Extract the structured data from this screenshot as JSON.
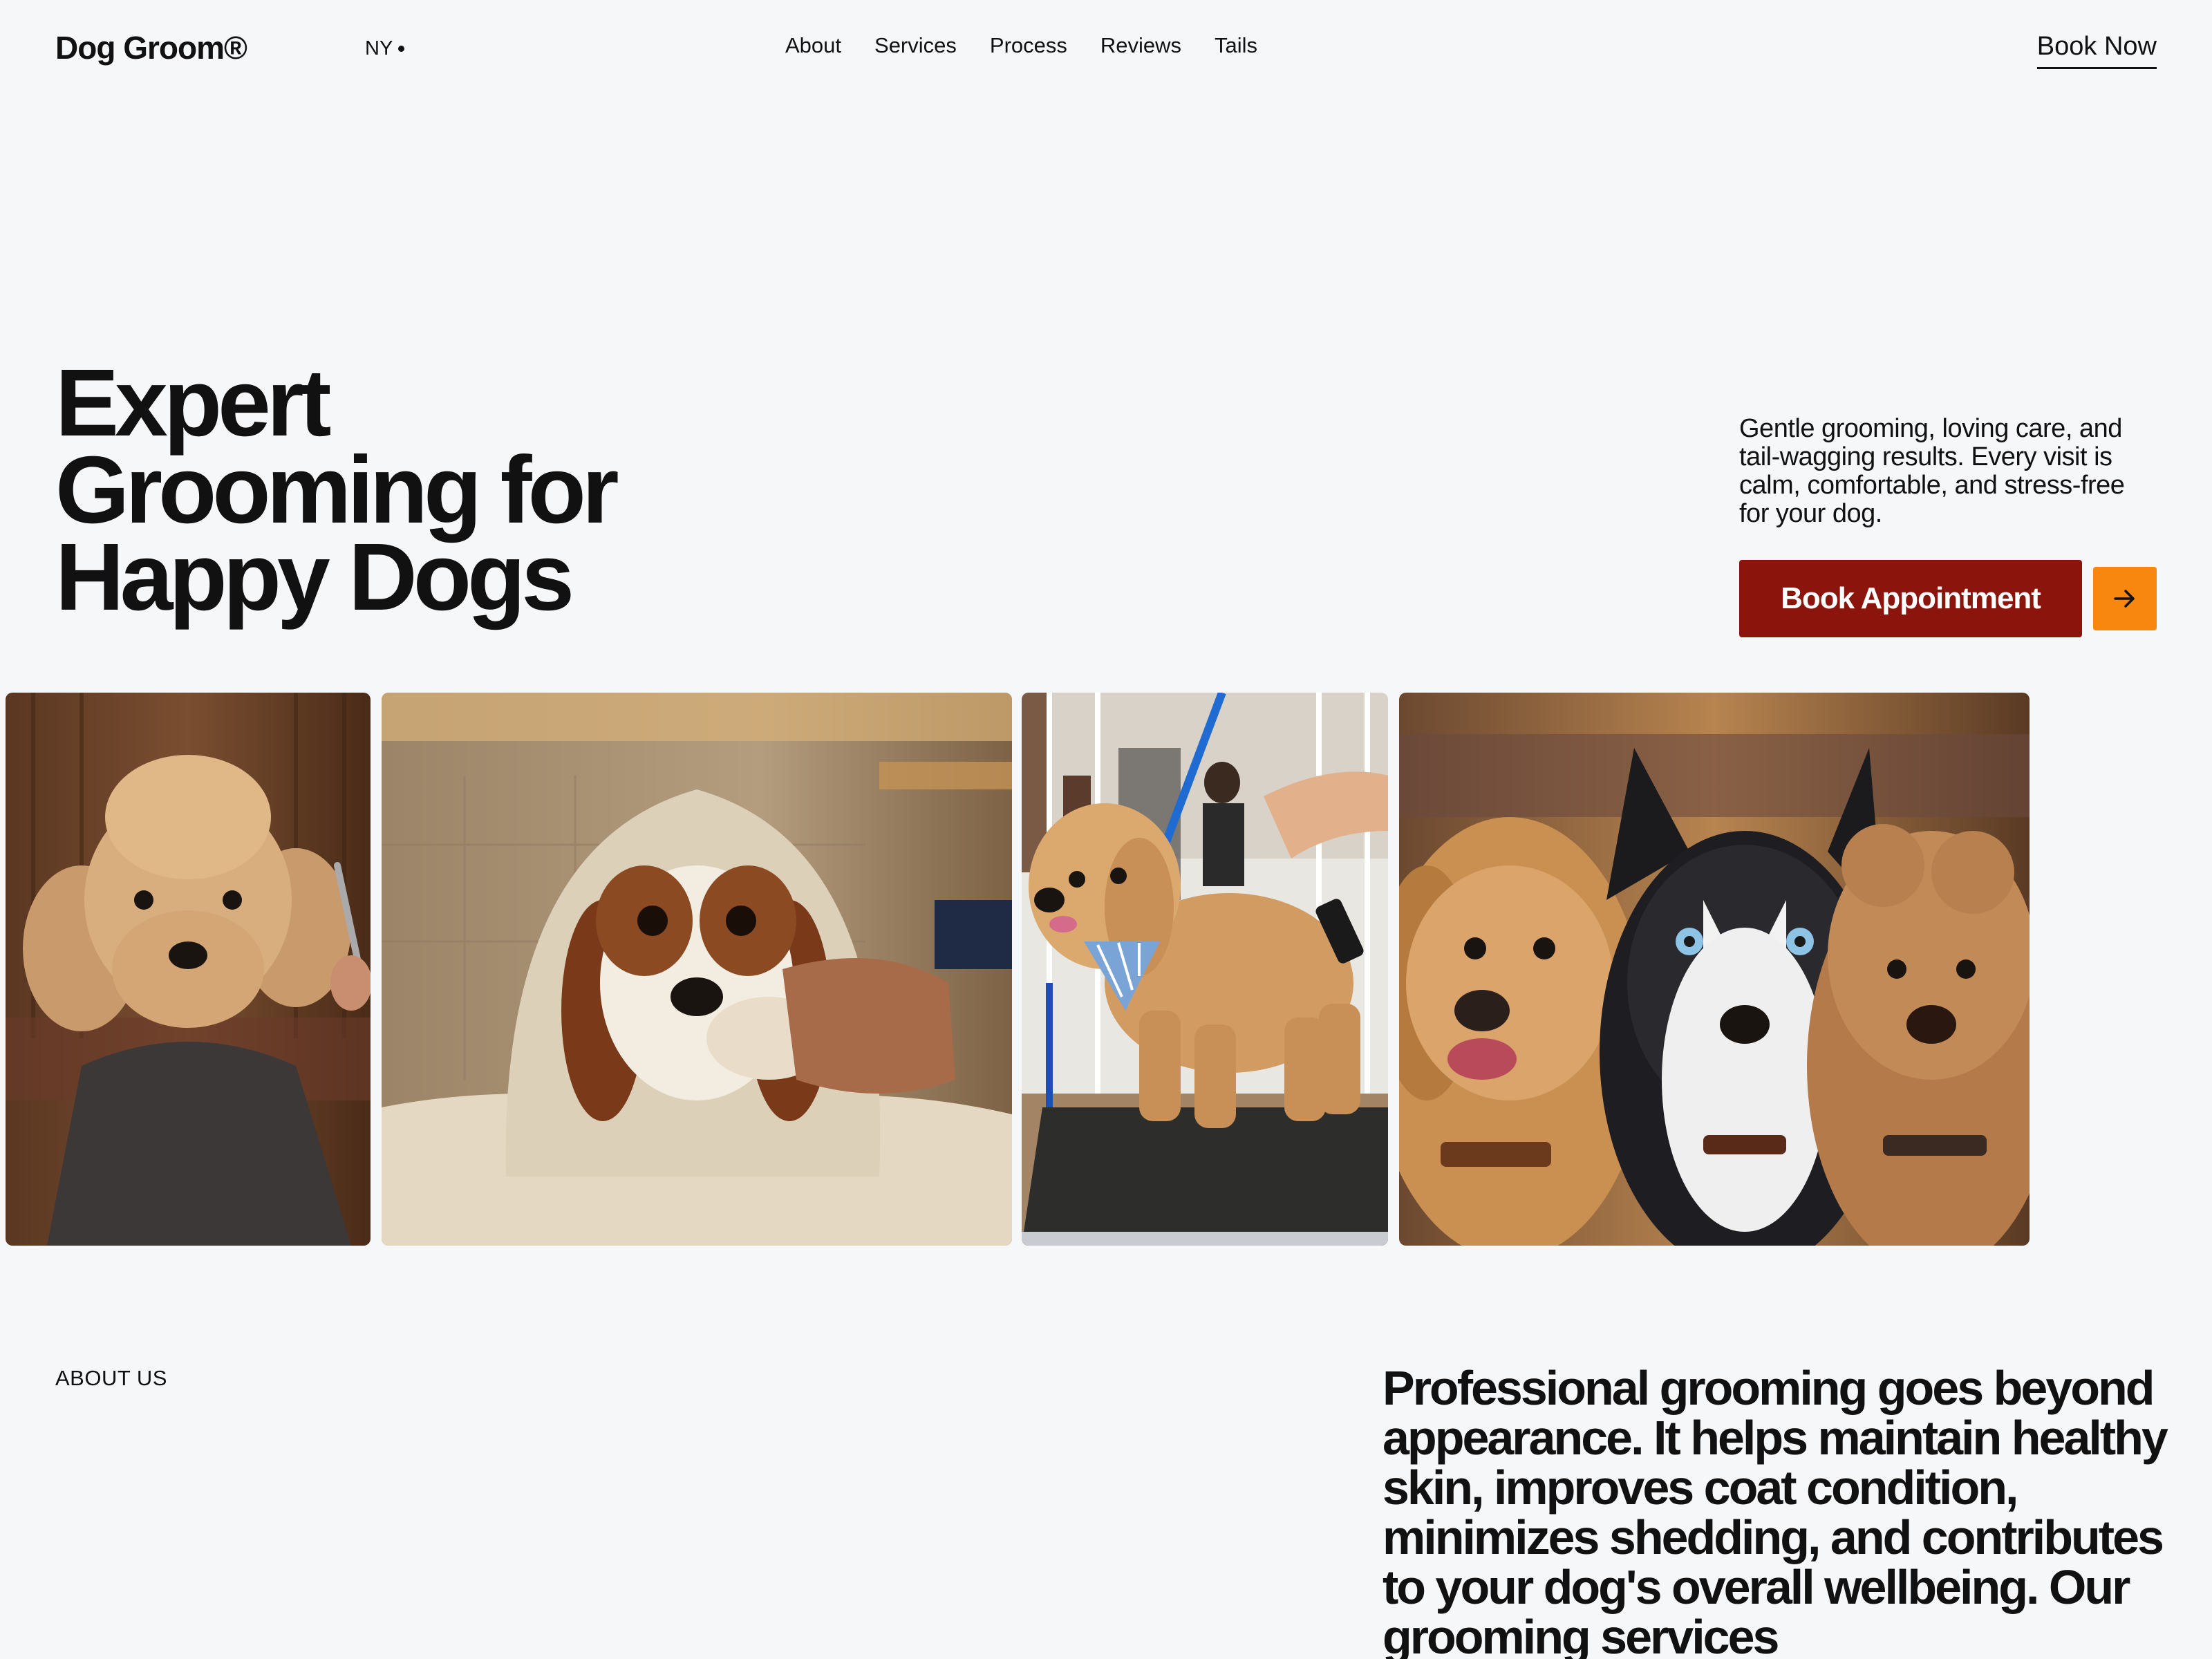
{
  "header": {
    "logo": "Dog Groom®",
    "location": "NY",
    "nav": [
      "About",
      "Services",
      "Process",
      "Reviews",
      "Tails"
    ],
    "book_now": "Book Now"
  },
  "hero": {
    "title_lines": [
      "Expert",
      "Grooming for",
      "Happy Dogs"
    ],
    "description": "Gentle grooming, loving care, and tail-wagging results. Every visit is calm, comfortable, and stress-free for your dog.",
    "cta_label": "Book Appointment",
    "arrow_icon": "arrow-right-icon"
  },
  "gallery": [
    {
      "name": "poodle-in-grooming-cape-photo"
    },
    {
      "name": "spaniel-in-towel-photo"
    },
    {
      "name": "doodle-on-grooming-table-photo"
    },
    {
      "name": "three-dogs-portrait-photo"
    }
  ],
  "about": {
    "label": "ABOUT US",
    "text": "Professional grooming goes beyond appearance. It helps maintain healthy skin, improves coat condition, minimizes shedding, and contributes to your dog's overall wellbeing. Our grooming services"
  },
  "colors": {
    "background": "#f6f7f9",
    "cta": "#8b150c",
    "accent": "#f7870f",
    "text": "#111111"
  }
}
